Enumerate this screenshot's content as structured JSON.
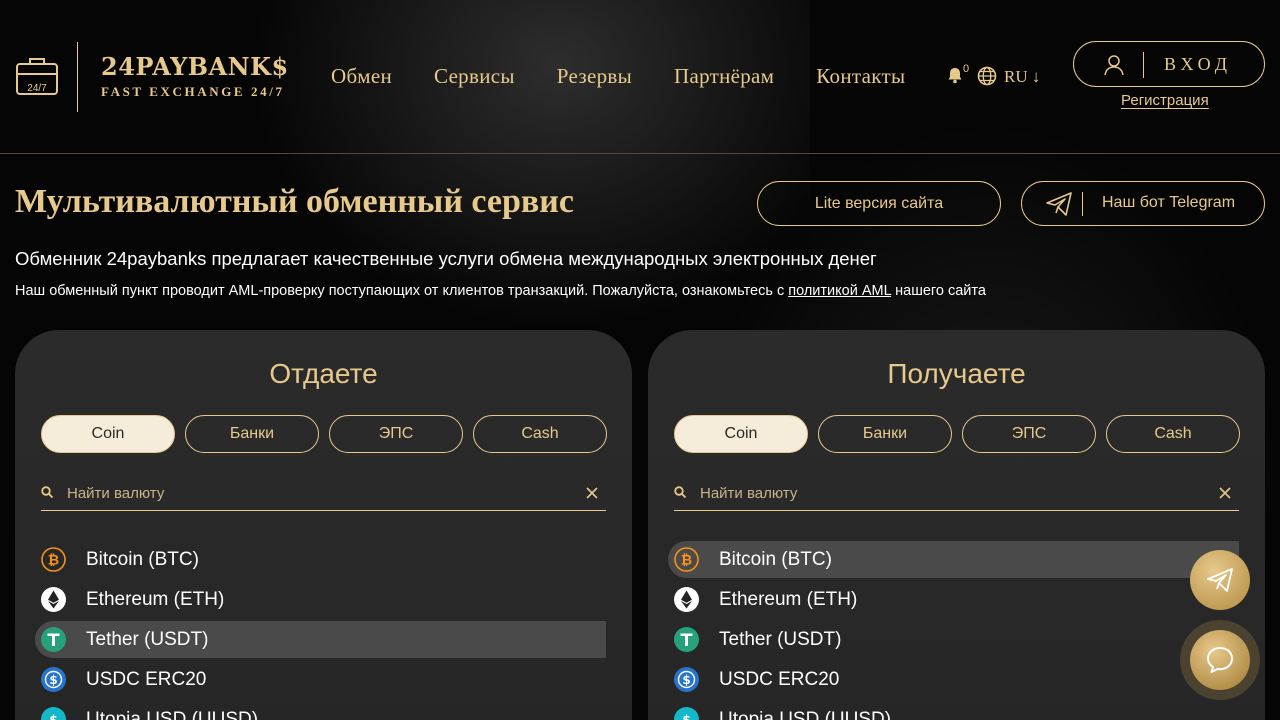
{
  "header": {
    "logo_name": "24PAYBANK$",
    "logo_tagline": "FAST EXCHANGE 24/7",
    "logo_badge": "24/7",
    "nav": [
      "Обмен",
      "Сервисы",
      "Резервы",
      "Партнёрам",
      "Контакты"
    ],
    "notification_count": "0",
    "language": "RU ↓",
    "login_label": "ВХОД",
    "register_label": "Регистрация"
  },
  "hero": {
    "title": "Мультивалютный обменный сервис",
    "lite_label": "Lite версия сайта",
    "telegram_label": "Наш бот Telegram",
    "intro": "Обменник 24paybanks предлагает качественные услуги обмена международных электронных денег",
    "aml_before": "Наш обменный пункт проводит AML-проверку поступающих от клиентов транзакций. Пожалуйста, ознакомьтесь с ",
    "aml_link": "политикой AML",
    "aml_after": " нашего сайта"
  },
  "give": {
    "title": "Отдаете",
    "tabs": [
      "Coin",
      "Банки",
      "ЭПС",
      "Cash"
    ],
    "active_tab": "Coin",
    "search_placeholder": "Найти валюту",
    "items": [
      "Bitcoin (BTC)",
      "Ethereum (ETH)",
      "Tether (USDT)",
      "USDC ERC20",
      "Utopia USD (UUSD)"
    ],
    "highlighted": "Tether (USDT)"
  },
  "get": {
    "title": "Получаете",
    "tabs": [
      "Coin",
      "Банки",
      "ЭПС",
      "Cash"
    ],
    "active_tab": "Coin",
    "search_placeholder": "Найти валюту",
    "items": [
      "Bitcoin (BTC)",
      "Ethereum (ETH)",
      "Tether (USDT)",
      "USDC ERC20",
      "Utopia USD (UUSD)"
    ],
    "highlighted": "Bitcoin (BTC)"
  },
  "colors": {
    "gold": "#e8c98c",
    "panel": "#2b2b2b",
    "btc": "#f7931a",
    "usdt": "#26a17b",
    "usdc": "#2775ca",
    "uusd": "#14b8c8"
  }
}
